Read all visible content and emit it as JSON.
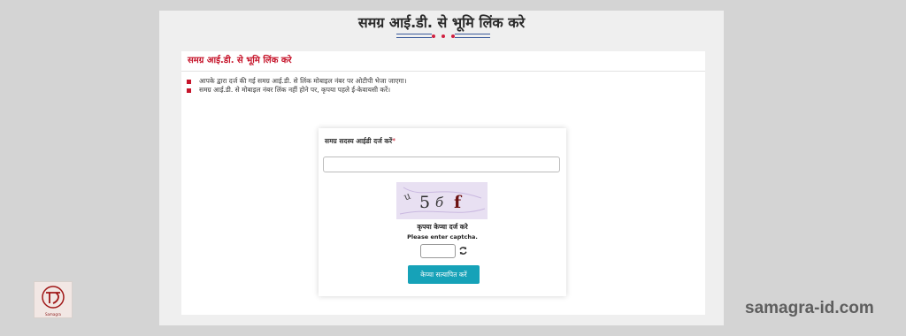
{
  "page": {
    "title": "समग्र आई.डी. से भूमि लिंक करे",
    "accent_color": "#c6152b",
    "button_color": "#16a2b8"
  },
  "panel": {
    "header": "समग्र आई.डी. से भूमि लिंक करे",
    "notes": [
      "आपके द्वारा दर्ज की गई समग्र आई.डी. से लिंक मोबाइल नंबर पर ओटीपी भेजा जाएगा।",
      "समग्र आई.डी. से मोबाइल नंबर लिंक नहीं होने पर, कृपया पहले ई-केवायसी करें।"
    ]
  },
  "form": {
    "id_label": "समग्र सदस्य आईडी दर्ज करें",
    "required_mark": "*",
    "id_value": "",
    "captcha_text": "u5б f",
    "captcha_caption": "कृपया केप्चा दर्ज करे",
    "captcha_hint": "Please enter captcha.",
    "captcha_value": "",
    "refresh_icon": "refresh-icon",
    "verify_button": "केप्चा सत्यापित करें"
  },
  "footer": {
    "watermark": "samagra-id.com",
    "logo_caption": "Samagra"
  }
}
